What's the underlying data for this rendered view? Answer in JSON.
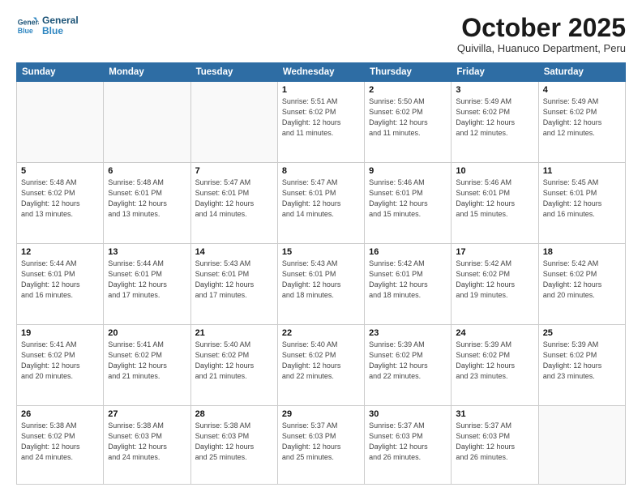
{
  "header": {
    "logo_line1": "General",
    "logo_line2": "Blue",
    "month": "October 2025",
    "location": "Quivilla, Huanuco Department, Peru"
  },
  "weekdays": [
    "Sunday",
    "Monday",
    "Tuesday",
    "Wednesday",
    "Thursday",
    "Friday",
    "Saturday"
  ],
  "weeks": [
    [
      {
        "day": "",
        "info": ""
      },
      {
        "day": "",
        "info": ""
      },
      {
        "day": "",
        "info": ""
      },
      {
        "day": "1",
        "info": "Sunrise: 5:51 AM\nSunset: 6:02 PM\nDaylight: 12 hours\nand 11 minutes."
      },
      {
        "day": "2",
        "info": "Sunrise: 5:50 AM\nSunset: 6:02 PM\nDaylight: 12 hours\nand 11 minutes."
      },
      {
        "day": "3",
        "info": "Sunrise: 5:49 AM\nSunset: 6:02 PM\nDaylight: 12 hours\nand 12 minutes."
      },
      {
        "day": "4",
        "info": "Sunrise: 5:49 AM\nSunset: 6:02 PM\nDaylight: 12 hours\nand 12 minutes."
      }
    ],
    [
      {
        "day": "5",
        "info": "Sunrise: 5:48 AM\nSunset: 6:02 PM\nDaylight: 12 hours\nand 13 minutes."
      },
      {
        "day": "6",
        "info": "Sunrise: 5:48 AM\nSunset: 6:01 PM\nDaylight: 12 hours\nand 13 minutes."
      },
      {
        "day": "7",
        "info": "Sunrise: 5:47 AM\nSunset: 6:01 PM\nDaylight: 12 hours\nand 14 minutes."
      },
      {
        "day": "8",
        "info": "Sunrise: 5:47 AM\nSunset: 6:01 PM\nDaylight: 12 hours\nand 14 minutes."
      },
      {
        "day": "9",
        "info": "Sunrise: 5:46 AM\nSunset: 6:01 PM\nDaylight: 12 hours\nand 15 minutes."
      },
      {
        "day": "10",
        "info": "Sunrise: 5:46 AM\nSunset: 6:01 PM\nDaylight: 12 hours\nand 15 minutes."
      },
      {
        "day": "11",
        "info": "Sunrise: 5:45 AM\nSunset: 6:01 PM\nDaylight: 12 hours\nand 16 minutes."
      }
    ],
    [
      {
        "day": "12",
        "info": "Sunrise: 5:44 AM\nSunset: 6:01 PM\nDaylight: 12 hours\nand 16 minutes."
      },
      {
        "day": "13",
        "info": "Sunrise: 5:44 AM\nSunset: 6:01 PM\nDaylight: 12 hours\nand 17 minutes."
      },
      {
        "day": "14",
        "info": "Sunrise: 5:43 AM\nSunset: 6:01 PM\nDaylight: 12 hours\nand 17 minutes."
      },
      {
        "day": "15",
        "info": "Sunrise: 5:43 AM\nSunset: 6:01 PM\nDaylight: 12 hours\nand 18 minutes."
      },
      {
        "day": "16",
        "info": "Sunrise: 5:42 AM\nSunset: 6:01 PM\nDaylight: 12 hours\nand 18 minutes."
      },
      {
        "day": "17",
        "info": "Sunrise: 5:42 AM\nSunset: 6:02 PM\nDaylight: 12 hours\nand 19 minutes."
      },
      {
        "day": "18",
        "info": "Sunrise: 5:42 AM\nSunset: 6:02 PM\nDaylight: 12 hours\nand 20 minutes."
      }
    ],
    [
      {
        "day": "19",
        "info": "Sunrise: 5:41 AM\nSunset: 6:02 PM\nDaylight: 12 hours\nand 20 minutes."
      },
      {
        "day": "20",
        "info": "Sunrise: 5:41 AM\nSunset: 6:02 PM\nDaylight: 12 hours\nand 21 minutes."
      },
      {
        "day": "21",
        "info": "Sunrise: 5:40 AM\nSunset: 6:02 PM\nDaylight: 12 hours\nand 21 minutes."
      },
      {
        "day": "22",
        "info": "Sunrise: 5:40 AM\nSunset: 6:02 PM\nDaylight: 12 hours\nand 22 minutes."
      },
      {
        "day": "23",
        "info": "Sunrise: 5:39 AM\nSunset: 6:02 PM\nDaylight: 12 hours\nand 22 minutes."
      },
      {
        "day": "24",
        "info": "Sunrise: 5:39 AM\nSunset: 6:02 PM\nDaylight: 12 hours\nand 23 minutes."
      },
      {
        "day": "25",
        "info": "Sunrise: 5:39 AM\nSunset: 6:02 PM\nDaylight: 12 hours\nand 23 minutes."
      }
    ],
    [
      {
        "day": "26",
        "info": "Sunrise: 5:38 AM\nSunset: 6:02 PM\nDaylight: 12 hours\nand 24 minutes."
      },
      {
        "day": "27",
        "info": "Sunrise: 5:38 AM\nSunset: 6:03 PM\nDaylight: 12 hours\nand 24 minutes."
      },
      {
        "day": "28",
        "info": "Sunrise: 5:38 AM\nSunset: 6:03 PM\nDaylight: 12 hours\nand 25 minutes."
      },
      {
        "day": "29",
        "info": "Sunrise: 5:37 AM\nSunset: 6:03 PM\nDaylight: 12 hours\nand 25 minutes."
      },
      {
        "day": "30",
        "info": "Sunrise: 5:37 AM\nSunset: 6:03 PM\nDaylight: 12 hours\nand 26 minutes."
      },
      {
        "day": "31",
        "info": "Sunrise: 5:37 AM\nSunset: 6:03 PM\nDaylight: 12 hours\nand 26 minutes."
      },
      {
        "day": "",
        "info": ""
      }
    ]
  ]
}
